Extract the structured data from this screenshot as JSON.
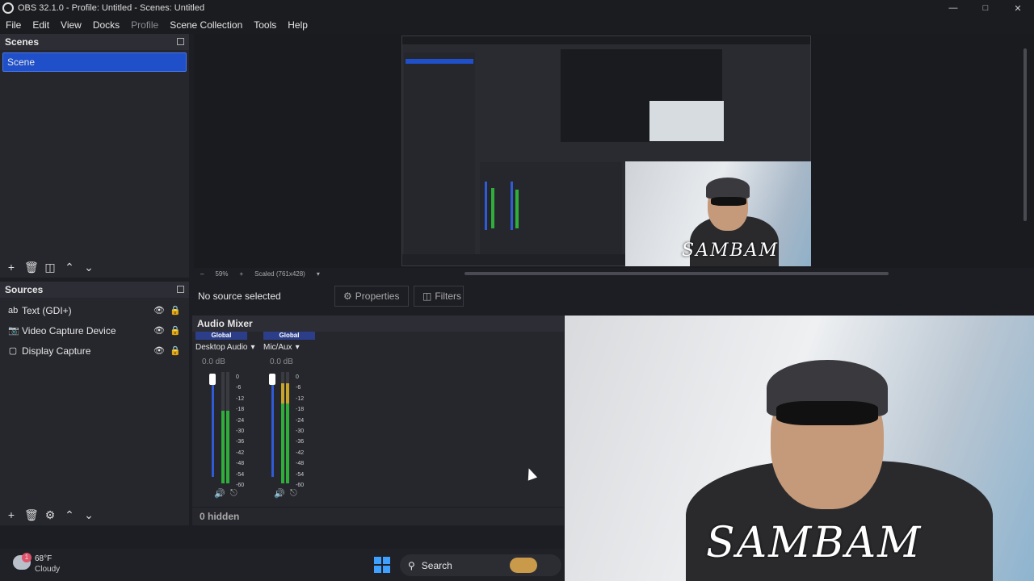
{
  "window": {
    "title": "OBS 32.1.0 - Profile: Untitled - Scenes: Untitled",
    "minimize": "—",
    "maximize": "□",
    "close": "✕"
  },
  "menu": [
    "File",
    "Edit",
    "View",
    "Docks",
    "Profile",
    "Scene Collection",
    "Tools",
    "Help"
  ],
  "scenes": {
    "title": "Scenes",
    "items": [
      "Scene"
    ]
  },
  "sources": {
    "title": "Sources",
    "items": [
      {
        "label": "Text (GDI+)",
        "icon": "text-icon"
      },
      {
        "label": "Video Capture Device",
        "icon": "camera-icon"
      },
      {
        "label": "Display Capture",
        "icon": "monitor-icon"
      }
    ]
  },
  "preview": {
    "zoom": "59%",
    "scale_mode": "Scaled (761x428)",
    "overlay_text": "SAMBAM"
  },
  "context": {
    "no_source": "No source selected",
    "properties": "Properties",
    "filters": "Filters"
  },
  "mixer": {
    "title": "Audio Mixer",
    "channels": [
      {
        "tag": "Global",
        "name": "Desktop Audio",
        "db": "0.0 dB",
        "level": 0.65
      },
      {
        "tag": "Global",
        "name": "Mic/Aux",
        "db": "0.0 dB",
        "level": 0.9
      }
    ],
    "ticks": [
      "0",
      "-6",
      "-12",
      "-18",
      "-24",
      "-30",
      "-36",
      "-42",
      "-48",
      "-54",
      "-60"
    ],
    "hidden": "0 hidden"
  },
  "taskbar": {
    "temp": "68°F",
    "weather": "Cloudy",
    "badge": "1",
    "search": "Search"
  },
  "colors": {
    "selected": "#1f4fc9",
    "accent": "#2f5bd6",
    "meter_green": "#2fae3a",
    "meter_yellow": "#c9a42a",
    "meter_red": "#b02a2a"
  }
}
